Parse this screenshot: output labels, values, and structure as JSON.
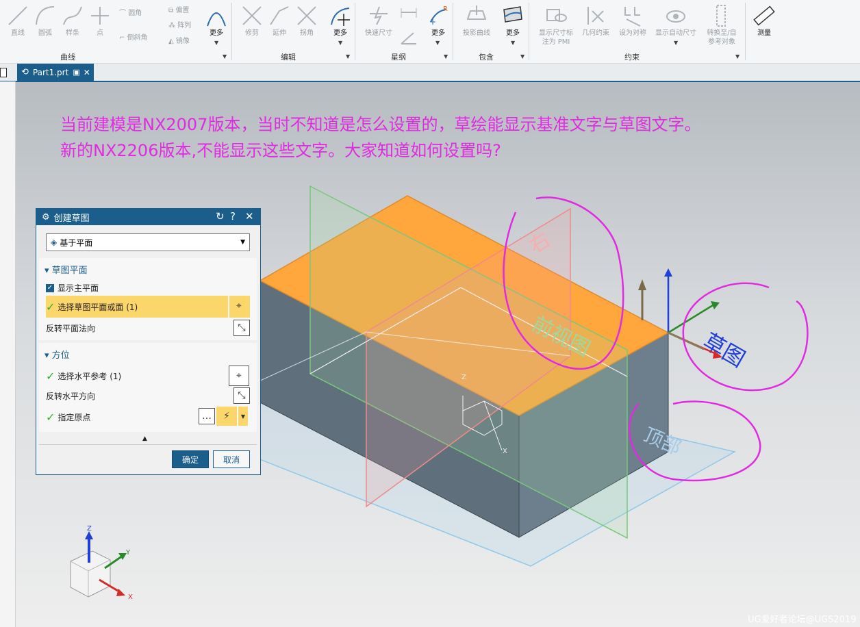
{
  "ribbon": {
    "curve_items": [
      {
        "label": "直线",
        "icon": "line-icon"
      },
      {
        "label": "圆弧",
        "icon": "arc-icon"
      },
      {
        "label": "样条",
        "icon": "spline-icon"
      },
      {
        "label": "点",
        "icon": "point-icon"
      }
    ],
    "curve_small": [
      "圆角",
      "倒斜角"
    ],
    "curve_small2": [
      "偏置",
      "阵列",
      "镜像"
    ],
    "curve_more": "更多",
    "curve_group": "曲线",
    "edit_items": [
      {
        "label": "修剪",
        "icon": "trim-icon"
      },
      {
        "label": "延伸",
        "icon": "extend-icon"
      },
      {
        "label": "拐角",
        "icon": "corner-icon"
      }
    ],
    "edit_more": "更多",
    "edit_group": "编辑",
    "dim_item": "快速尺寸",
    "dim_more": "更多",
    "dim_group": "星纲",
    "include_item": "投影曲线",
    "include_more": "更多",
    "include_group": "包含",
    "constraint_items": [
      "显示尺寸标\n注为 PMI",
      "几何约束",
      "设为对称",
      "显示自动尺寸",
      "转换至/自\n参考对象"
    ],
    "constraint_group": "约束",
    "measure": "测量"
  },
  "tab": {
    "label": "Part1.prt"
  },
  "question": {
    "line1": "当前建模是NX2007版本，当时不知道是怎么设置的，草绘能显示基准文字与草图文字。",
    "line2": "新的NX2206版本,不能显示这些文字。大家知道如何设置吗?"
  },
  "dialog": {
    "title": "创建草图",
    "select_value": "基于平面",
    "section1": "草图平面",
    "show_main_plane": "显示主平面",
    "select_plane": "选择草图平面或面 (1)",
    "flip_normal": "反转平面法向",
    "section2": "方位",
    "select_horizontal": "选择水平参考 (1)",
    "flip_horizontal": "反转水平方向",
    "specify_origin": "指定原点",
    "ok": "确定",
    "cancel": "取消"
  },
  "scene": {
    "label_right": "右",
    "label_front": "前视图",
    "label_sketch": "草图",
    "label_top": "顶部",
    "axis_x": "X",
    "axis_y": "Y",
    "axis_z": "Z",
    "annotation_color": "#e02be0",
    "face_color": "#ffa63c",
    "block_color": "#5f6f7c"
  },
  "watermark": "UG爱好者论坛@UGS2019"
}
